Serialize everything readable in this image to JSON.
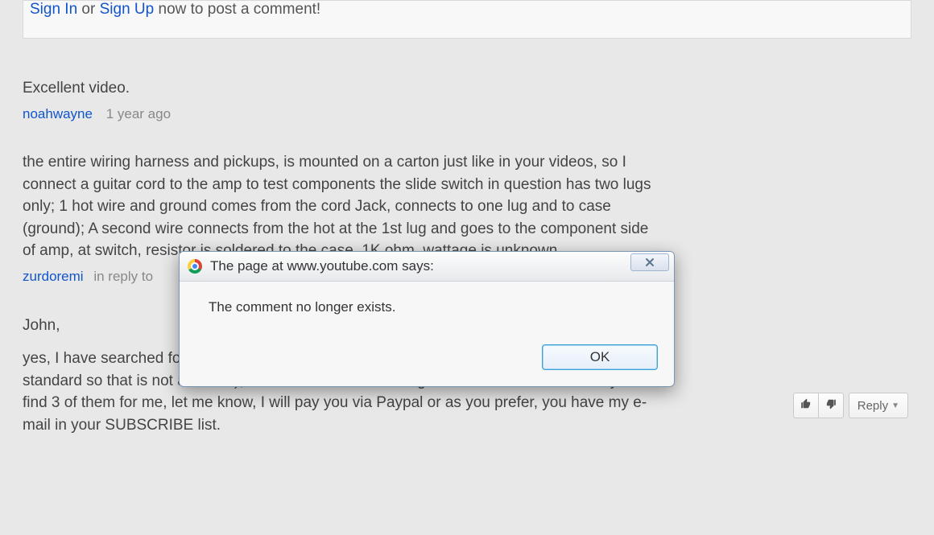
{
  "signin": {
    "sign_in_link": "Sign In",
    "between": " or ",
    "sign_up_link": "Sign Up",
    "rest": " now to post a comment!"
  },
  "comments": [
    {
      "text": "Excellent video.",
      "author": "noahwayne",
      "time": "1 year ago"
    },
    {
      "text": "the entire wiring harness and pickups, is mounted on a carton just like in your videos, so I connect a guitar cord to the amp to test components the slide switch in question has two lugs only; 1 hot wire and ground comes from the cord Jack, connects to one lug and to case (ground); A second wire connects from the hot at the 1st lug and goes to the component side of amp, at switch, resistor is soldered to the case, 1K ohm, wattage is unknown.",
      "truncation_note": "unknown.",
      "author": "zurdoremi",
      "in_reply_to": "in reply to"
    },
    {
      "opening": "John,",
      "text": "yes, I have searched for a two-lug slide switch SPST but no luck, ( the screw hole spacing is standard so that is not an issue), the issue has been finding the ON-ON slide switch. If you find 3 of them for me, let me know, I will pay you via Paypal or as you prefer, you have my e-mail in your SUBSCRIBE list."
    }
  ],
  "reply_bar": {
    "reply_label": "Reply"
  },
  "dialog": {
    "title": "The page at www.youtube.com says:",
    "message": "The comment no longer exists.",
    "ok_label": "OK"
  }
}
